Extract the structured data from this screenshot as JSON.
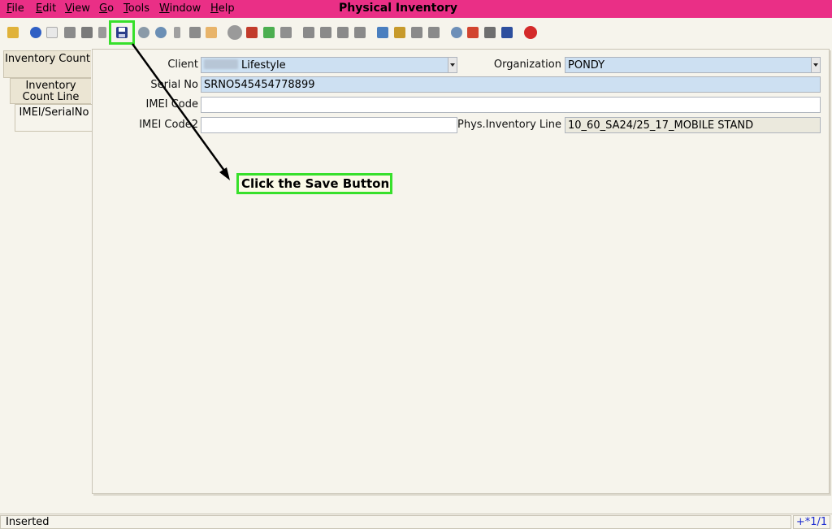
{
  "window": {
    "title": "Physical Inventory"
  },
  "menu": [
    {
      "label": "File",
      "key": "F"
    },
    {
      "label": "Edit",
      "key": "E"
    },
    {
      "label": "View",
      "key": "V"
    },
    {
      "label": "Go",
      "key": "G"
    },
    {
      "label": "Tools",
      "key": "T"
    },
    {
      "label": "Window",
      "key": "W"
    },
    {
      "label": "Help",
      "key": "H"
    }
  ],
  "toolbar": {
    "icons": [
      "undo-icon",
      "help-icon",
      "new-record-icon",
      "copy-record-icon",
      "delete-icon",
      "delete-selection-icon",
      "save-icon",
      "refresh-icon",
      "find-icon",
      "attachment-icon",
      "chat-icon",
      "grid-toggle-icon",
      "history-icon",
      "home-icon",
      "back-icon",
      "forward-icon",
      "first-record-icon",
      "previous-record-icon",
      "next-record-icon",
      "last-record-icon",
      "report-icon",
      "archive-icon",
      "print-preview-icon",
      "print-icon",
      "zoom-across-icon",
      "workflow-icon",
      "product-info-icon",
      "request-icon",
      "close-window-icon"
    ]
  },
  "tabs": [
    {
      "label": "Inventory Count"
    },
    {
      "label": "Inventory Count Line"
    },
    {
      "label": "IMEI/SerialNo"
    }
  ],
  "form": {
    "client_label": "Client",
    "client_value": "Lifestyle",
    "organization_label": "Organization",
    "organization_value": "PONDY",
    "serial_label": "Serial No",
    "serial_value": "SRNO545454778899",
    "imei_label": "IMEI Code",
    "imei_value": "",
    "imei2_label": "IMEI Code2",
    "imei2_value": "",
    "phys_line_label": "Phys.Inventory Line",
    "phys_line_value": "10_60_SA24/25_17_MOBILE STAND"
  },
  "annotation": {
    "text": "Click the Save Button"
  },
  "status": {
    "message": "Inserted",
    "record": "+*1/1"
  },
  "colors": {
    "menubar": "#ea2f86",
    "highlight": "#37e02b",
    "field_blue": "#cde0f2"
  }
}
